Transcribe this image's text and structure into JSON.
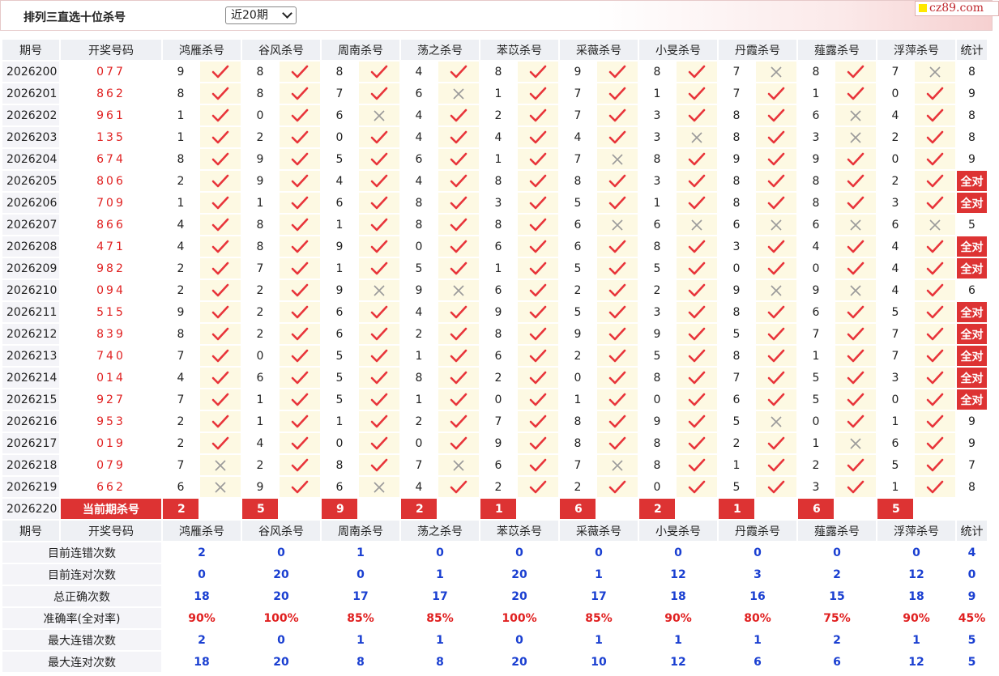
{
  "header": {
    "title": "排列三直选十位杀号",
    "period_select": "近20期",
    "logo_text": "cz89.com"
  },
  "table": {
    "headers": [
      "期号",
      "开奖号码",
      "鸿雁杀号",
      "谷风杀号",
      "周南杀号",
      "荡之杀号",
      "苯苡杀号",
      "采薇杀号",
      "小旻杀号",
      "丹霞杀号",
      "薤露杀号",
      "浮萍杀号",
      "统计"
    ],
    "rows": [
      {
        "qi": "2026200",
        "kj": "077",
        "kills": [
          "9",
          "8",
          "8",
          "4",
          "8",
          "9",
          "8",
          "7",
          "8",
          "7"
        ],
        "marks": [
          1,
          1,
          1,
          1,
          1,
          1,
          1,
          0,
          1,
          0
        ],
        "stat": "8"
      },
      {
        "qi": "2026201",
        "kj": "862",
        "kills": [
          "8",
          "8",
          "7",
          "6",
          "1",
          "7",
          "1",
          "7",
          "1",
          "0"
        ],
        "marks": [
          1,
          1,
          1,
          0,
          1,
          1,
          1,
          1,
          1,
          1
        ],
        "stat": "9"
      },
      {
        "qi": "2026202",
        "kj": "961",
        "kills": [
          "1",
          "0",
          "6",
          "4",
          "2",
          "7",
          "3",
          "8",
          "6",
          "4"
        ],
        "marks": [
          1,
          1,
          0,
          1,
          1,
          1,
          1,
          1,
          0,
          1
        ],
        "stat": "8"
      },
      {
        "qi": "2026203",
        "kj": "135",
        "kills": [
          "1",
          "2",
          "0",
          "4",
          "4",
          "4",
          "3",
          "8",
          "3",
          "2"
        ],
        "marks": [
          1,
          1,
          1,
          1,
          1,
          1,
          0,
          1,
          0,
          1
        ],
        "stat": "8"
      },
      {
        "qi": "2026204",
        "kj": "674",
        "kills": [
          "8",
          "9",
          "5",
          "6",
          "1",
          "7",
          "8",
          "9",
          "9",
          "0"
        ],
        "marks": [
          1,
          1,
          1,
          1,
          1,
          0,
          1,
          1,
          1,
          1
        ],
        "stat": "9"
      },
      {
        "qi": "2026205",
        "kj": "806",
        "kills": [
          "2",
          "9",
          "4",
          "4",
          "8",
          "8",
          "3",
          "8",
          "8",
          "2"
        ],
        "marks": [
          1,
          1,
          1,
          1,
          1,
          1,
          1,
          1,
          1,
          1
        ],
        "stat": "全对"
      },
      {
        "qi": "2026206",
        "kj": "709",
        "kills": [
          "1",
          "1",
          "6",
          "8",
          "3",
          "5",
          "1",
          "8",
          "8",
          "3"
        ],
        "marks": [
          1,
          1,
          1,
          1,
          1,
          1,
          1,
          1,
          1,
          1
        ],
        "stat": "全对"
      },
      {
        "qi": "2026207",
        "kj": "866",
        "kills": [
          "4",
          "8",
          "1",
          "8",
          "8",
          "6",
          "6",
          "6",
          "6",
          "6"
        ],
        "marks": [
          1,
          1,
          1,
          1,
          1,
          0,
          0,
          0,
          0,
          0
        ],
        "stat": "5"
      },
      {
        "qi": "2026208",
        "kj": "471",
        "kills": [
          "4",
          "8",
          "9",
          "0",
          "6",
          "6",
          "8",
          "3",
          "4",
          "4"
        ],
        "marks": [
          1,
          1,
          1,
          1,
          1,
          1,
          1,
          1,
          1,
          1
        ],
        "stat": "全对"
      },
      {
        "qi": "2026209",
        "kj": "982",
        "kills": [
          "2",
          "7",
          "1",
          "5",
          "1",
          "5",
          "5",
          "0",
          "0",
          "4"
        ],
        "marks": [
          1,
          1,
          1,
          1,
          1,
          1,
          1,
          1,
          1,
          1
        ],
        "stat": "全对"
      },
      {
        "qi": "2026210",
        "kj": "094",
        "kills": [
          "2",
          "2",
          "9",
          "9",
          "6",
          "2",
          "2",
          "9",
          "9",
          "4"
        ],
        "marks": [
          1,
          1,
          0,
          0,
          1,
          1,
          1,
          0,
          0,
          1
        ],
        "stat": "6"
      },
      {
        "qi": "2026211",
        "kj": "515",
        "kills": [
          "9",
          "2",
          "6",
          "4",
          "9",
          "5",
          "3",
          "8",
          "6",
          "5"
        ],
        "marks": [
          1,
          1,
          1,
          1,
          1,
          1,
          1,
          1,
          1,
          1
        ],
        "stat": "全对"
      },
      {
        "qi": "2026212",
        "kj": "839",
        "kills": [
          "8",
          "2",
          "6",
          "2",
          "8",
          "9",
          "9",
          "5",
          "7",
          "7"
        ],
        "marks": [
          1,
          1,
          1,
          1,
          1,
          1,
          1,
          1,
          1,
          1
        ],
        "stat": "全对"
      },
      {
        "qi": "2026213",
        "kj": "740",
        "kills": [
          "7",
          "0",
          "5",
          "1",
          "6",
          "2",
          "5",
          "8",
          "1",
          "7"
        ],
        "marks": [
          1,
          1,
          1,
          1,
          1,
          1,
          1,
          1,
          1,
          1
        ],
        "stat": "全对"
      },
      {
        "qi": "2026214",
        "kj": "014",
        "kills": [
          "4",
          "6",
          "5",
          "8",
          "2",
          "0",
          "8",
          "7",
          "5",
          "3"
        ],
        "marks": [
          1,
          1,
          1,
          1,
          1,
          1,
          1,
          1,
          1,
          1
        ],
        "stat": "全对"
      },
      {
        "qi": "2026215",
        "kj": "927",
        "kills": [
          "7",
          "1",
          "5",
          "1",
          "0",
          "1",
          "0",
          "6",
          "5",
          "0"
        ],
        "marks": [
          1,
          1,
          1,
          1,
          1,
          1,
          1,
          1,
          1,
          1
        ],
        "stat": "全对"
      },
      {
        "qi": "2026216",
        "kj": "953",
        "kills": [
          "2",
          "1",
          "1",
          "2",
          "7",
          "8",
          "9",
          "5",
          "0",
          "1"
        ],
        "marks": [
          1,
          1,
          1,
          1,
          1,
          1,
          1,
          0,
          1,
          1
        ],
        "stat": "9"
      },
      {
        "qi": "2026217",
        "kj": "019",
        "kills": [
          "2",
          "4",
          "0",
          "0",
          "9",
          "8",
          "8",
          "2",
          "1",
          "6"
        ],
        "marks": [
          1,
          1,
          1,
          1,
          1,
          1,
          1,
          1,
          0,
          1
        ],
        "stat": "9"
      },
      {
        "qi": "2026218",
        "kj": "079",
        "kills": [
          "7",
          "2",
          "8",
          "7",
          "6",
          "7",
          "8",
          "1",
          "2",
          "5"
        ],
        "marks": [
          0,
          1,
          1,
          0,
          1,
          0,
          1,
          1,
          1,
          1
        ],
        "stat": "7"
      },
      {
        "qi": "2026219",
        "kj": "662",
        "kills": [
          "6",
          "9",
          "6",
          "4",
          "2",
          "2",
          "0",
          "5",
          "3",
          "1"
        ],
        "marks": [
          0,
          1,
          0,
          1,
          1,
          1,
          1,
          1,
          1,
          1
        ],
        "stat": "8"
      }
    ],
    "current": {
      "qi": "2026220",
      "label": "当前期杀号",
      "kills": [
        "2",
        "5",
        "9",
        "2",
        "1",
        "6",
        "2",
        "1",
        "6",
        "5"
      ]
    },
    "stats": [
      {
        "label": "目前连错次数",
        "values": [
          "2",
          "0",
          "1",
          "0",
          "0",
          "0",
          "0",
          "0",
          "0",
          "0",
          "4"
        ],
        "red": false
      },
      {
        "label": "目前连对次数",
        "values": [
          "0",
          "20",
          "0",
          "1",
          "20",
          "1",
          "12",
          "3",
          "2",
          "12",
          "0"
        ],
        "red": false
      },
      {
        "label": "总正确次数",
        "values": [
          "18",
          "20",
          "17",
          "17",
          "20",
          "17",
          "18",
          "16",
          "15",
          "18",
          "9"
        ],
        "red": false
      },
      {
        "label": "准确率(全对率)",
        "values": [
          "90%",
          "100%",
          "85%",
          "85%",
          "100%",
          "85%",
          "90%",
          "80%",
          "75%",
          "90%",
          "45%"
        ],
        "red": true
      },
      {
        "label": "最大连错次数",
        "values": [
          "2",
          "0",
          "1",
          "1",
          "0",
          "1",
          "1",
          "1",
          "2",
          "1",
          "5"
        ],
        "red": false
      },
      {
        "label": "最大连对次数",
        "values": [
          "18",
          "20",
          "8",
          "8",
          "20",
          "10",
          "12",
          "6",
          "6",
          "12",
          "5"
        ],
        "red": false
      }
    ]
  },
  "colors": {
    "accent_red": "#d33333",
    "check_red": "#e8343a",
    "cross_gray": "#9a9a9a",
    "stat_blue": "#1a3fd1",
    "mark_bg": "#fdf9e3"
  },
  "icons": {
    "correct": "check-icon",
    "wrong": "cross-icon"
  }
}
